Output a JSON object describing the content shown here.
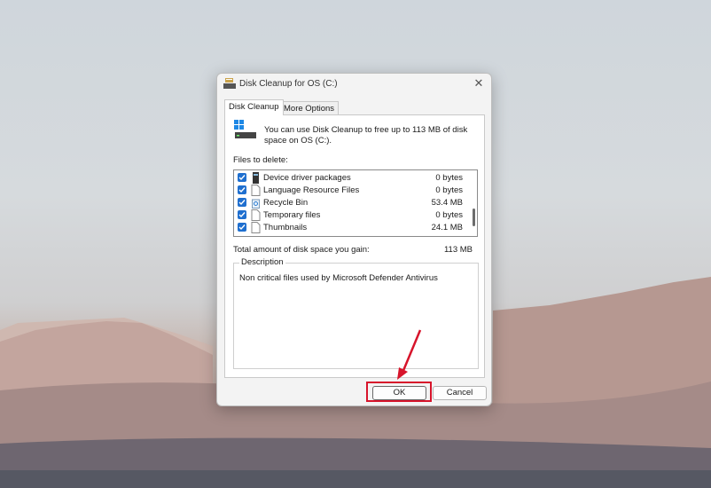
{
  "window": {
    "title": "Disk Cleanup for OS (C:)"
  },
  "tabs": [
    {
      "label": "Disk Cleanup",
      "active": true
    },
    {
      "label": "More Options",
      "active": false
    }
  ],
  "intro_text": "You can use Disk Cleanup to free up to 113 MB of disk space on OS (C:).",
  "files_label": "Files to delete:",
  "files": [
    {
      "name": "Device driver packages",
      "size": "0 bytes",
      "checked": true,
      "icon": "driver-icon"
    },
    {
      "name": "Language Resource Files",
      "size": "0 bytes",
      "checked": true,
      "icon": "file-icon"
    },
    {
      "name": "Recycle Bin",
      "size": "53.4 MB",
      "checked": true,
      "icon": "recycle-bin-icon"
    },
    {
      "name": "Temporary files",
      "size": "0 bytes",
      "checked": true,
      "icon": "file-icon"
    },
    {
      "name": "Thumbnails",
      "size": "24.1 MB",
      "checked": true,
      "icon": "file-icon"
    }
  ],
  "total": {
    "label": "Total amount of disk space you gain:",
    "value": "113 MB"
  },
  "description": {
    "legend": "Description",
    "text": "Non critical files used by Microsoft Defender Antivirus"
  },
  "buttons": {
    "ok": "OK",
    "cancel": "Cancel"
  },
  "colors": {
    "checkbox": "#1f6fcf",
    "highlight": "#d7142b"
  }
}
